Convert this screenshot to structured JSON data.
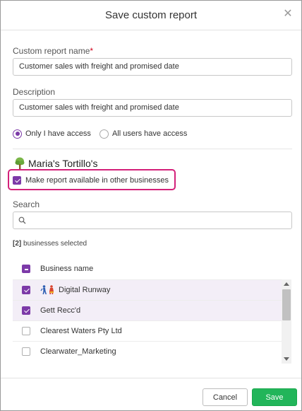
{
  "dialog": {
    "title": "Save custom report",
    "close_icon": "close-icon"
  },
  "form": {
    "report_name_label": "Custom report name",
    "required_marker": "*",
    "report_name_value": "Customer sales with freight and promised date",
    "description_label": "Description",
    "description_value": "Customer sales with freight and promised date",
    "access_options": [
      {
        "label": "Only I have access",
        "selected": true
      },
      {
        "label": "All users have access",
        "selected": false
      }
    ]
  },
  "business": {
    "icon": "tree-icon",
    "name": "Maria's Tortillo's",
    "make_available_label": "Make report available in other businesses",
    "make_available_checked": true
  },
  "search": {
    "label": "Search",
    "placeholder": "",
    "icon": "search-icon"
  },
  "selection": {
    "count_text": "[2]",
    "suffix_text": " businesses selected"
  },
  "business_list": {
    "header_label": "Business name",
    "header_state": "indeterminate",
    "rows": [
      {
        "name": "Digital Runway",
        "checked": true,
        "icons": [
          "runner-blue-icon",
          "runner-red-icon"
        ]
      },
      {
        "name": "Gett Recc'd",
        "checked": true,
        "icons": []
      },
      {
        "name": "Clearest Waters Pty Ltd",
        "checked": false,
        "icons": []
      },
      {
        "name": "Clearwater_Marketing",
        "checked": false,
        "icons": []
      }
    ]
  },
  "footer": {
    "cancel_label": "Cancel",
    "save_label": "Save"
  },
  "colors": {
    "accent_purple": "#7c3aa8",
    "highlight_pink": "#d4217a",
    "save_green": "#22b55a",
    "selected_row_bg": "#f3eef7"
  }
}
